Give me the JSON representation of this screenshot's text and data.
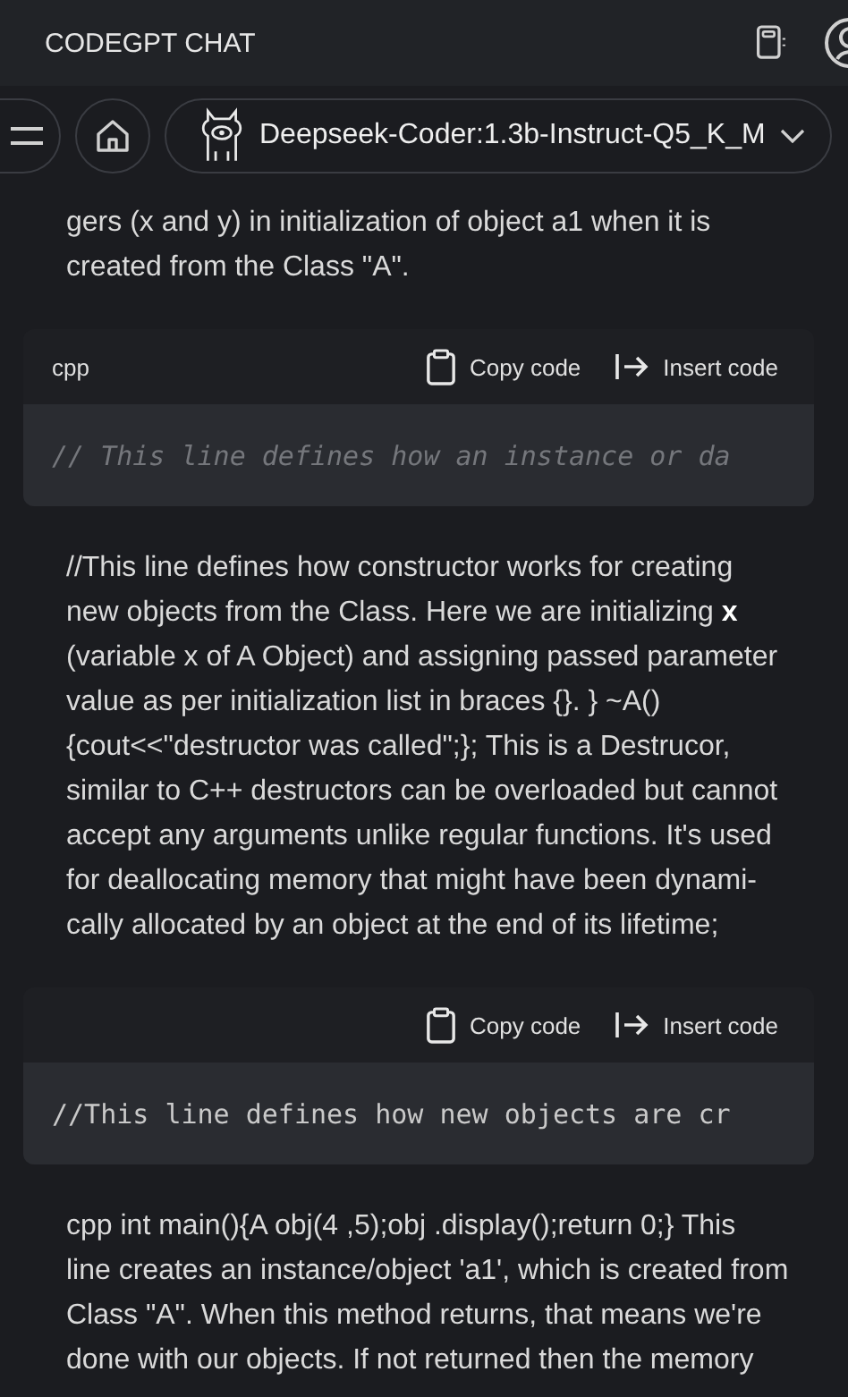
{
  "header": {
    "title": "CODEGPT CHAT"
  },
  "toolbar": {
    "model": "Deepseek-Coder:1.3b-Instruct-Q5_K_M"
  },
  "messages": [
    {
      "kind": "text",
      "text": "gers (x and y) in initialization of object a1 when it is\ncreated from the Class \"A\"."
    },
    {
      "kind": "code",
      "language": "cpp",
      "copy": "Copy code",
      "insert": "Insert code",
      "code": "// This line defines how an instance or da",
      "italic": true
    },
    {
      "kind": "text",
      "text": "//This line defines how constructor works for creating\nnew objects from the Class. Here we are initializing **x**\n(variable x of A Object) and assigning passed parameter\nvalue as per initialization list in braces {}. } ~A()\n{cout<<\"destructor was called\";}; This is a Destrucor,\nsimilar to C++ destructors can be overloaded but cannot\naccept any arguments unlike regular functions. It's used\nfor deallocating memory that might have been dynami-\ncally allocated by an object at the end of its lifetime;"
    },
    {
      "kind": "code",
      "copy": "Copy code",
      "insert": "Insert code",
      "code": "//This line defines how new objects are cr",
      "italic": false
    },
    {
      "kind": "text",
      "text": "cpp int main(){A obj(4 ,5);obj .display();return 0;} This\nline creates an instance/object 'a1', which is created from\nClass \"A\". When this method returns, that means we're\ndone with our objects. If not returned then the memory"
    }
  ]
}
